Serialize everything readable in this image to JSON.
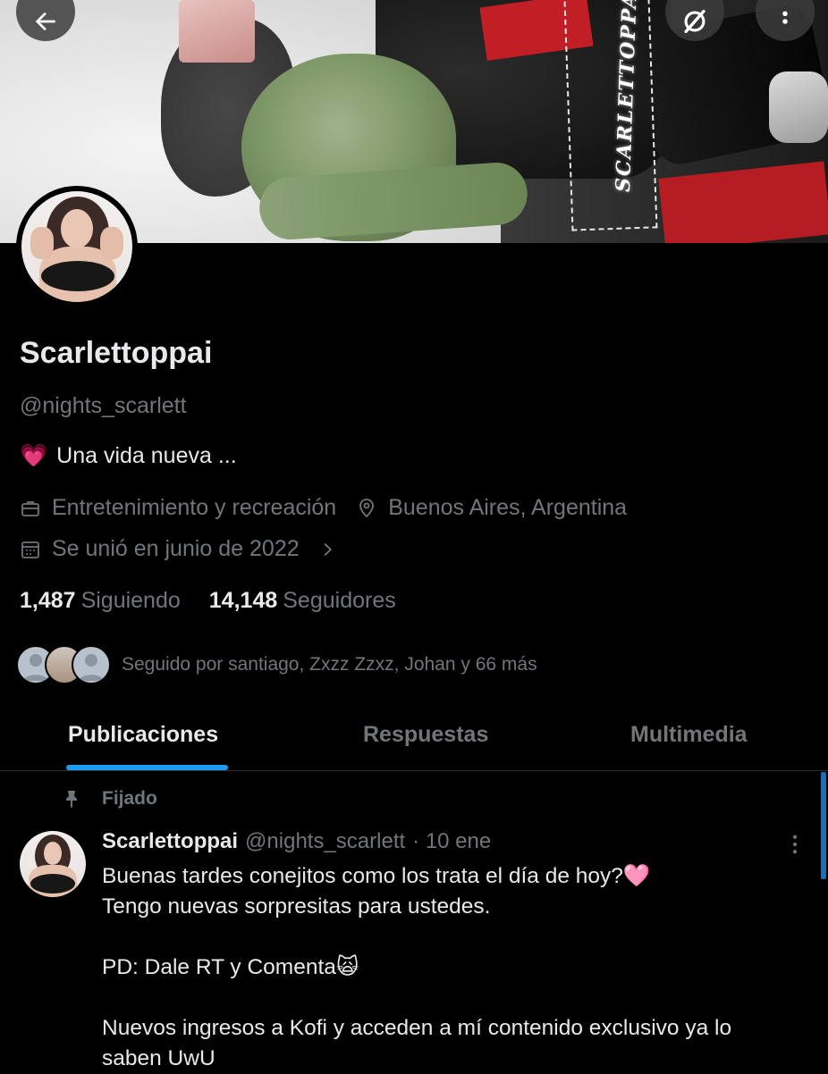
{
  "banner": {
    "watermark": "SCARLETTOPPAI"
  },
  "profile": {
    "name": "Scarlettoppai",
    "handle": "@nights_scarlett",
    "bio": "Una vida nueva ...",
    "bio_emoji": "💗",
    "category": "Entretenimiento y recreación",
    "location": "Buenos Aires, Argentina",
    "joined": "Se unió en junio de 2022",
    "following_count": "1,487",
    "following_label": "Siguiendo",
    "followers_count": "14,148",
    "followers_label": "Seguidores",
    "followed_by": "Seguido por santiago, Zxzz Zzxz, Johan y 66 más"
  },
  "tabs": [
    {
      "label": "Publicaciones",
      "active": true
    },
    {
      "label": "Respuestas",
      "active": false
    },
    {
      "label": "Multimedia",
      "active": false
    }
  ],
  "post": {
    "pinned_label": "Fijado",
    "author": "Scarlettoppai",
    "handle": "@nights_scarlett",
    "time": "· 10 ene",
    "lines": [
      "Buenas tardes conejitos como los trata el día de hoy?🩷",
      "Tengo nuevas sorpresitas para ustedes.",
      "",
      "PD: Dale RT y Comenta🙀",
      "",
      "Nuevos ingresos a Kofi y acceden a mí contenido exclusivo ya lo",
      "saben UwU"
    ]
  },
  "colors": {
    "accent": "#1d9bf0",
    "secondary_text": "#71767b",
    "primary_text": "#e7e9ea",
    "background": "#000000"
  }
}
